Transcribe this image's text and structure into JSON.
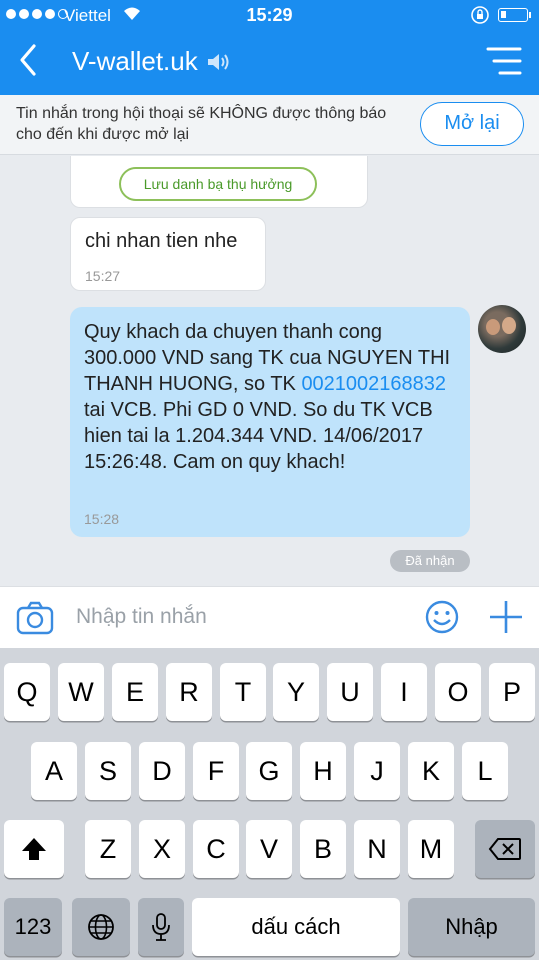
{
  "status": {
    "carrier": "Viettel",
    "time": "15:29"
  },
  "nav": {
    "title": "V-wallet.uk"
  },
  "notice": {
    "text": "Tin nhắn trong hội thoại sẽ KHÔNG được thông báo cho đến khi được mở lại",
    "button": "Mở lại"
  },
  "chat": {
    "card_button": "Lưu danh bạ thụ hưởng",
    "incoming": {
      "text": "chi nhan tien nhe",
      "time": "15:27"
    },
    "outgoing": {
      "text_before": "Quy khach da chuyen thanh cong 300.000 VND sang TK cua NGUYEN THI THANH HUONG, so TK ",
      "account": "0021002168832",
      "text_after": " tai VCB. Phi GD 0 VND. So du TK VCB hien tai la 1.204.344 VND. 14/06/2017 15:26:48. Cam on quy khach!",
      "time": "15:28"
    },
    "status_badge": "Đã nhận"
  },
  "input": {
    "placeholder": "Nhập tin nhắn"
  },
  "keyboard": {
    "row1": [
      "Q",
      "W",
      "E",
      "R",
      "T",
      "Y",
      "U",
      "I",
      "O",
      "P"
    ],
    "row2": [
      "A",
      "S",
      "D",
      "F",
      "G",
      "H",
      "J",
      "K",
      "L"
    ],
    "row3": [
      "Z",
      "X",
      "C",
      "V",
      "B",
      "N",
      "M"
    ],
    "numbers_key": "123",
    "space_key": "dấu cách",
    "return_key": "Nhập"
  },
  "colors": {
    "accent": "#1a8df0",
    "outgoing_bubble": "#bfe3fb"
  }
}
